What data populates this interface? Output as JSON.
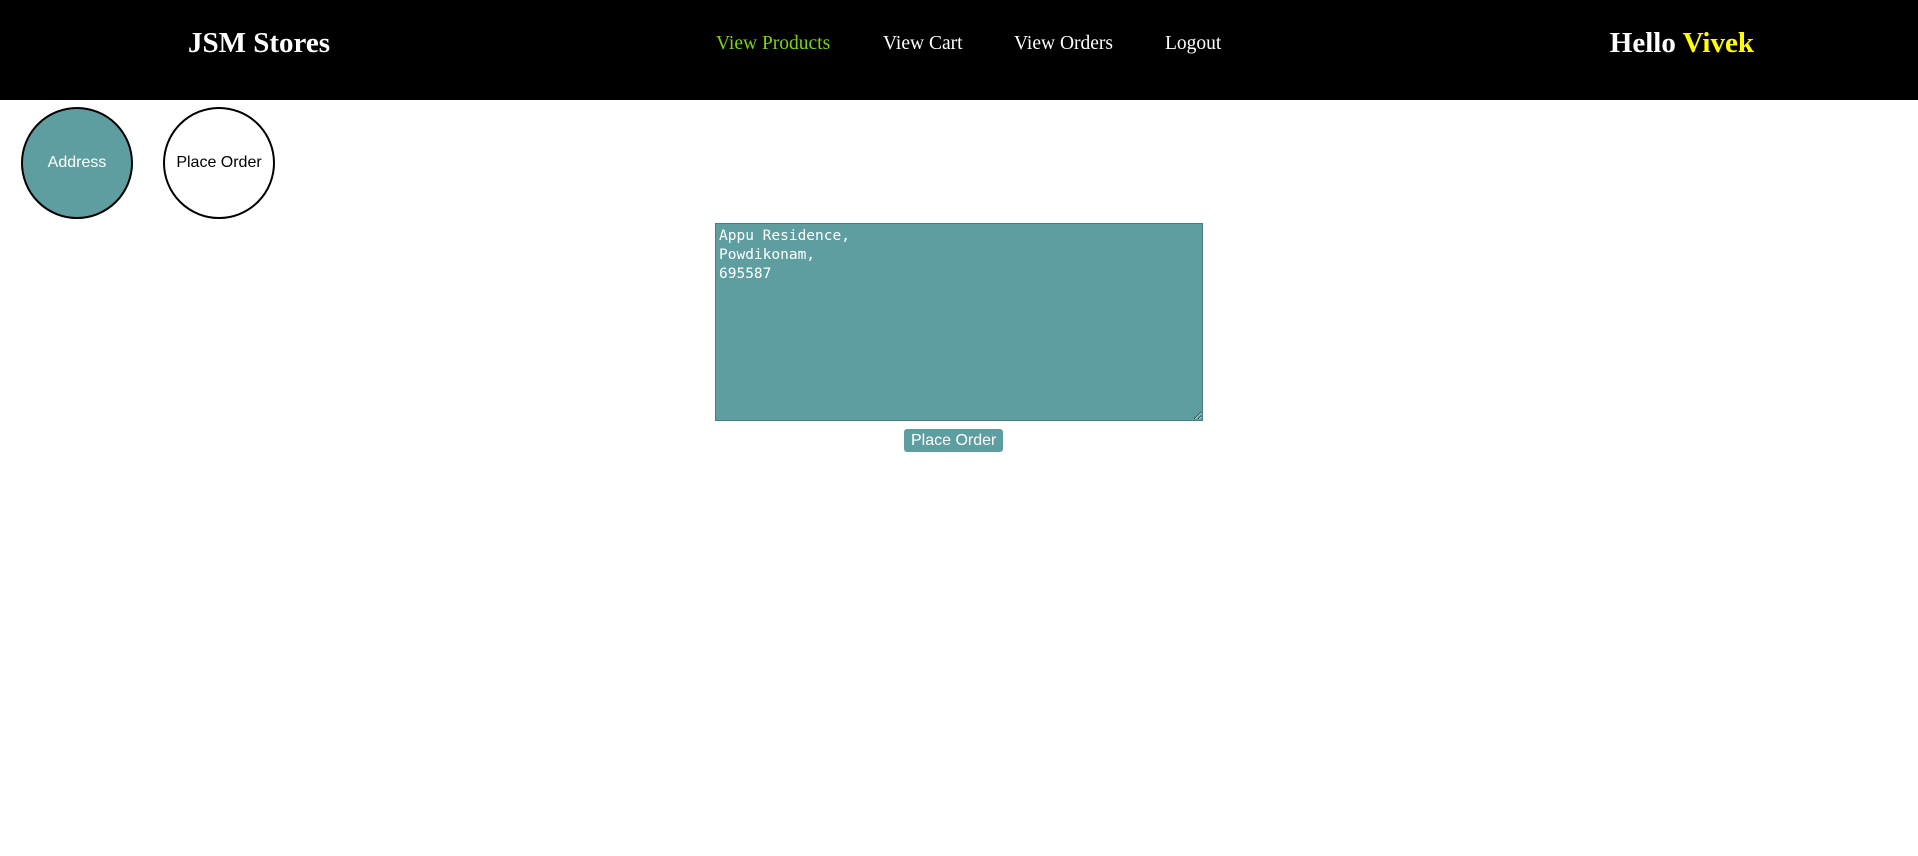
{
  "header": {
    "brand": "JSM Stores",
    "nav": [
      {
        "label": "View Products",
        "active": true
      },
      {
        "label": "View Cart",
        "active": false
      },
      {
        "label": "View Orders",
        "active": false
      },
      {
        "label": "Logout",
        "active": false
      }
    ],
    "greeting_prefix": "Hello",
    "username": "Vivek"
  },
  "steps": [
    {
      "label": "Address",
      "active": true
    },
    {
      "label": "Place Order",
      "active": false
    }
  ],
  "address": {
    "value": "Appu Residence,\nPowdikonam,\n695587"
  },
  "place_order_button": "Place Order",
  "colors": {
    "navbar_bg": "#000000",
    "nav_active": "#7cd318",
    "username_color": "#ffff00",
    "accent": "#5f9ea0"
  }
}
